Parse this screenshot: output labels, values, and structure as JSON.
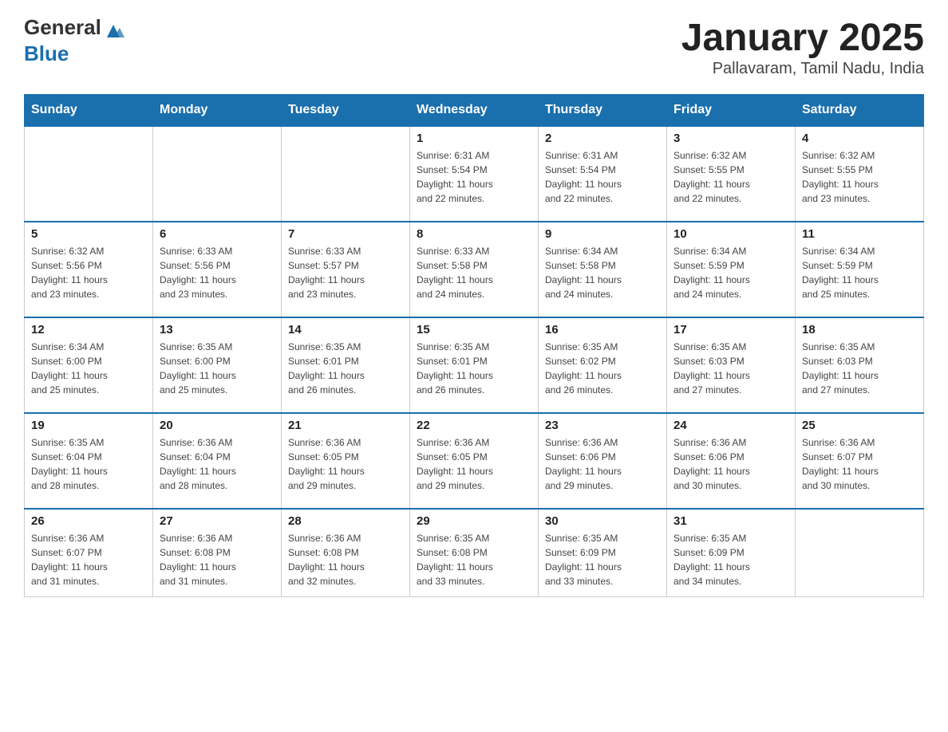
{
  "header": {
    "logo_general": "General",
    "logo_blue": "Blue",
    "title": "January 2025",
    "subtitle": "Pallavaram, Tamil Nadu, India"
  },
  "days_of_week": [
    "Sunday",
    "Monday",
    "Tuesday",
    "Wednesday",
    "Thursday",
    "Friday",
    "Saturday"
  ],
  "weeks": [
    [
      {
        "day": "",
        "info": ""
      },
      {
        "day": "",
        "info": ""
      },
      {
        "day": "",
        "info": ""
      },
      {
        "day": "1",
        "info": "Sunrise: 6:31 AM\nSunset: 5:54 PM\nDaylight: 11 hours\nand 22 minutes."
      },
      {
        "day": "2",
        "info": "Sunrise: 6:31 AM\nSunset: 5:54 PM\nDaylight: 11 hours\nand 22 minutes."
      },
      {
        "day": "3",
        "info": "Sunrise: 6:32 AM\nSunset: 5:55 PM\nDaylight: 11 hours\nand 22 minutes."
      },
      {
        "day": "4",
        "info": "Sunrise: 6:32 AM\nSunset: 5:55 PM\nDaylight: 11 hours\nand 23 minutes."
      }
    ],
    [
      {
        "day": "5",
        "info": "Sunrise: 6:32 AM\nSunset: 5:56 PM\nDaylight: 11 hours\nand 23 minutes."
      },
      {
        "day": "6",
        "info": "Sunrise: 6:33 AM\nSunset: 5:56 PM\nDaylight: 11 hours\nand 23 minutes."
      },
      {
        "day": "7",
        "info": "Sunrise: 6:33 AM\nSunset: 5:57 PM\nDaylight: 11 hours\nand 23 minutes."
      },
      {
        "day": "8",
        "info": "Sunrise: 6:33 AM\nSunset: 5:58 PM\nDaylight: 11 hours\nand 24 minutes."
      },
      {
        "day": "9",
        "info": "Sunrise: 6:34 AM\nSunset: 5:58 PM\nDaylight: 11 hours\nand 24 minutes."
      },
      {
        "day": "10",
        "info": "Sunrise: 6:34 AM\nSunset: 5:59 PM\nDaylight: 11 hours\nand 24 minutes."
      },
      {
        "day": "11",
        "info": "Sunrise: 6:34 AM\nSunset: 5:59 PM\nDaylight: 11 hours\nand 25 minutes."
      }
    ],
    [
      {
        "day": "12",
        "info": "Sunrise: 6:34 AM\nSunset: 6:00 PM\nDaylight: 11 hours\nand 25 minutes."
      },
      {
        "day": "13",
        "info": "Sunrise: 6:35 AM\nSunset: 6:00 PM\nDaylight: 11 hours\nand 25 minutes."
      },
      {
        "day": "14",
        "info": "Sunrise: 6:35 AM\nSunset: 6:01 PM\nDaylight: 11 hours\nand 26 minutes."
      },
      {
        "day": "15",
        "info": "Sunrise: 6:35 AM\nSunset: 6:01 PM\nDaylight: 11 hours\nand 26 minutes."
      },
      {
        "day": "16",
        "info": "Sunrise: 6:35 AM\nSunset: 6:02 PM\nDaylight: 11 hours\nand 26 minutes."
      },
      {
        "day": "17",
        "info": "Sunrise: 6:35 AM\nSunset: 6:03 PM\nDaylight: 11 hours\nand 27 minutes."
      },
      {
        "day": "18",
        "info": "Sunrise: 6:35 AM\nSunset: 6:03 PM\nDaylight: 11 hours\nand 27 minutes."
      }
    ],
    [
      {
        "day": "19",
        "info": "Sunrise: 6:35 AM\nSunset: 6:04 PM\nDaylight: 11 hours\nand 28 minutes."
      },
      {
        "day": "20",
        "info": "Sunrise: 6:36 AM\nSunset: 6:04 PM\nDaylight: 11 hours\nand 28 minutes."
      },
      {
        "day": "21",
        "info": "Sunrise: 6:36 AM\nSunset: 6:05 PM\nDaylight: 11 hours\nand 29 minutes."
      },
      {
        "day": "22",
        "info": "Sunrise: 6:36 AM\nSunset: 6:05 PM\nDaylight: 11 hours\nand 29 minutes."
      },
      {
        "day": "23",
        "info": "Sunrise: 6:36 AM\nSunset: 6:06 PM\nDaylight: 11 hours\nand 29 minutes."
      },
      {
        "day": "24",
        "info": "Sunrise: 6:36 AM\nSunset: 6:06 PM\nDaylight: 11 hours\nand 30 minutes."
      },
      {
        "day": "25",
        "info": "Sunrise: 6:36 AM\nSunset: 6:07 PM\nDaylight: 11 hours\nand 30 minutes."
      }
    ],
    [
      {
        "day": "26",
        "info": "Sunrise: 6:36 AM\nSunset: 6:07 PM\nDaylight: 11 hours\nand 31 minutes."
      },
      {
        "day": "27",
        "info": "Sunrise: 6:36 AM\nSunset: 6:08 PM\nDaylight: 11 hours\nand 31 minutes."
      },
      {
        "day": "28",
        "info": "Sunrise: 6:36 AM\nSunset: 6:08 PM\nDaylight: 11 hours\nand 32 minutes."
      },
      {
        "day": "29",
        "info": "Sunrise: 6:35 AM\nSunset: 6:08 PM\nDaylight: 11 hours\nand 33 minutes."
      },
      {
        "day": "30",
        "info": "Sunrise: 6:35 AM\nSunset: 6:09 PM\nDaylight: 11 hours\nand 33 minutes."
      },
      {
        "day": "31",
        "info": "Sunrise: 6:35 AM\nSunset: 6:09 PM\nDaylight: 11 hours\nand 34 minutes."
      },
      {
        "day": "",
        "info": ""
      }
    ]
  ]
}
